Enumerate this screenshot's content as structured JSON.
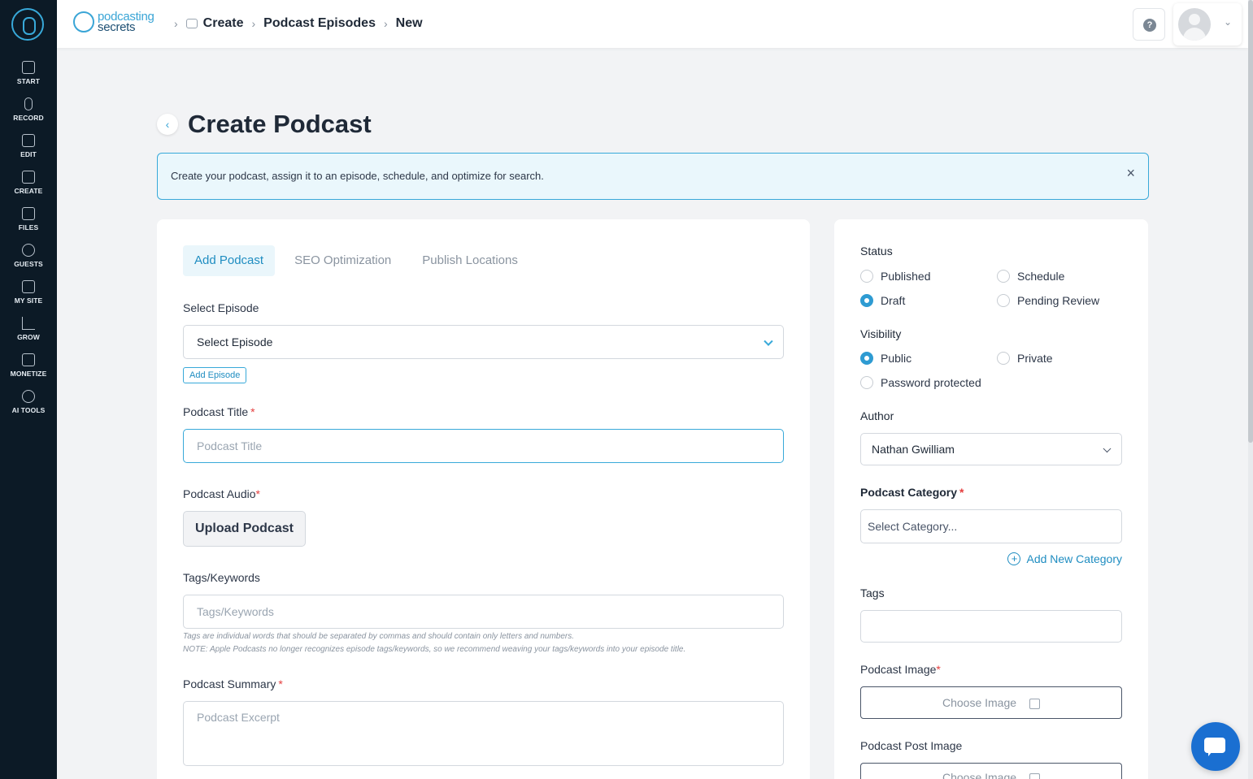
{
  "sidebar": {
    "items": [
      {
        "label": "START",
        "icon": "home-icon"
      },
      {
        "label": "RECORD",
        "icon": "microphone-icon"
      },
      {
        "label": "EDIT",
        "icon": "edit-icon"
      },
      {
        "label": "CREATE",
        "icon": "create-icon"
      },
      {
        "label": "FILES",
        "icon": "files-icon"
      },
      {
        "label": "GUESTS",
        "icon": "guests-icon"
      },
      {
        "label": "MY SITE",
        "icon": "site-icon"
      },
      {
        "label": "GROW",
        "icon": "chart-icon"
      },
      {
        "label": "MONETIZE",
        "icon": "monetize-icon"
      },
      {
        "label": "AI TOOLS",
        "icon": "ai-icon"
      }
    ]
  },
  "header": {
    "brand_top": "podcasting",
    "brand_bottom": "secrets",
    "breadcrumb": [
      "Create",
      "Podcast Episodes",
      "New"
    ],
    "help_glyph": "?"
  },
  "page": {
    "title": "Create Podcast",
    "banner_text": "Create your podcast, assign it to an episode, schedule, and optimize for search.",
    "close_glyph": "×"
  },
  "tabs": [
    "Add Podcast",
    "SEO Optimization",
    "Publish Locations"
  ],
  "form": {
    "episode_label": "Select Episode",
    "episode_value": "Select Episode",
    "add_episode": "Add Episode",
    "title_label": "Podcast Title",
    "title_placeholder": "Podcast Title",
    "audio_label": "Podcast Audio",
    "upload_label": "Upload Podcast",
    "tags_label": "Tags/Keywords",
    "tags_placeholder": "Tags/Keywords",
    "tags_hint_1": "Tags are individual words that should be separated by commas and should contain only letters and numbers.",
    "tags_hint_2": "NOTE: Apple Podcasts no longer recognizes episode tags/keywords, so we recommend weaving your tags/keywords into your episode title.",
    "summary_label": "Podcast Summary",
    "summary_placeholder": "Podcast Excerpt",
    "required_mark": "*"
  },
  "side": {
    "status_label": "Status",
    "status_options": [
      "Published",
      "Schedule",
      "Draft",
      "Pending Review"
    ],
    "status_selected": "Draft",
    "visibility_label": "Visibility",
    "visibility_options": [
      "Public",
      "Private",
      "Password protected"
    ],
    "visibility_selected": "Public",
    "author_label": "Author",
    "author_value": "Nathan Gwilliam",
    "category_label": "Podcast Category",
    "category_placeholder": "Select Category...",
    "add_category": "Add New Category",
    "tags_label": "Tags",
    "image_label": "Podcast Image",
    "choose_image": "Choose Image",
    "post_image_label": "Podcast Post Image"
  },
  "colors": {
    "accent": "#38a9d9",
    "sidebar_bg": "#0c1a26",
    "required": "#e53e3e",
    "chat": "#1a6fd1"
  }
}
